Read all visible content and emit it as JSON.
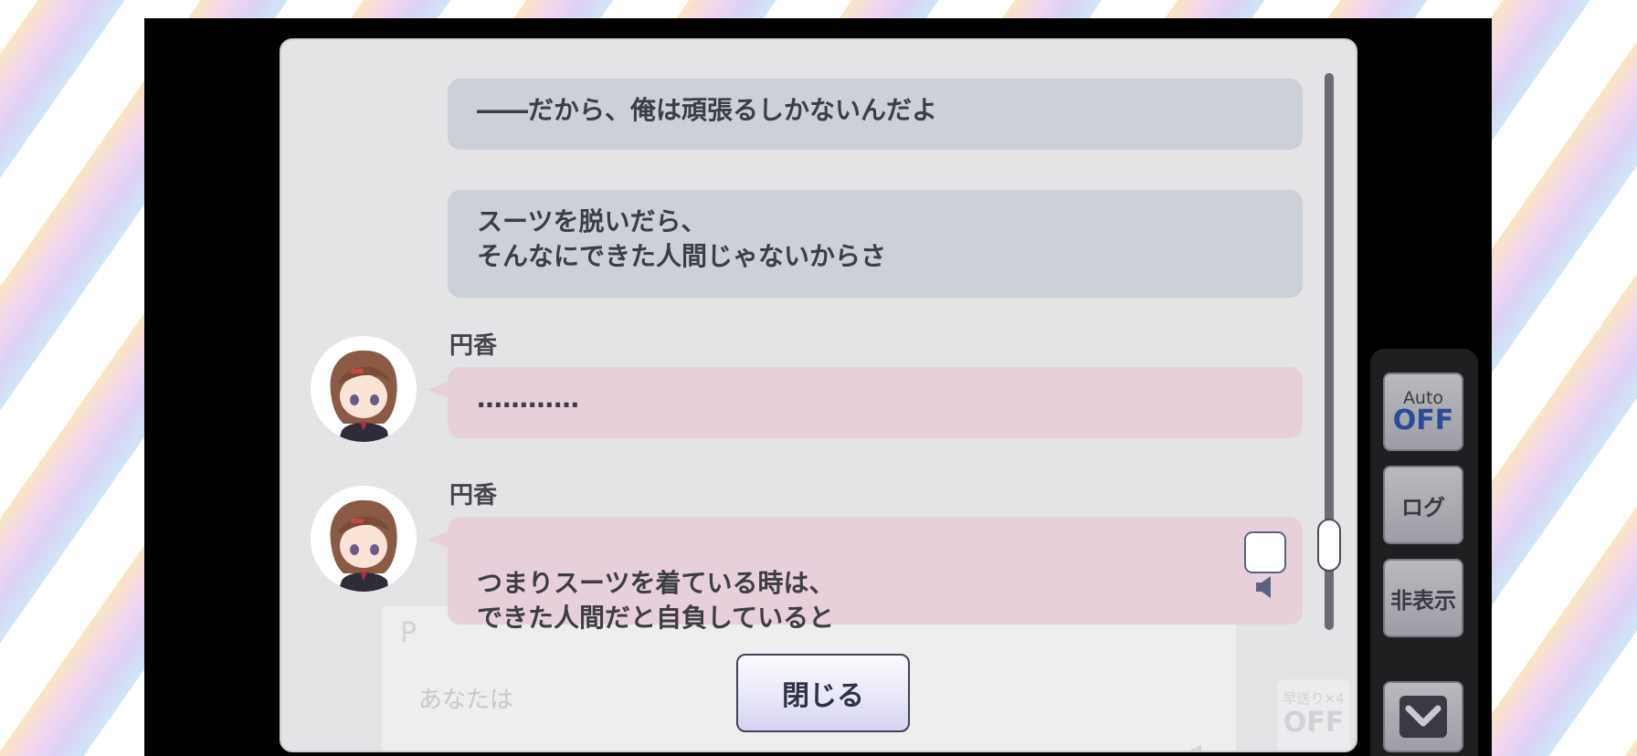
{
  "log": {
    "entries": [
      {
        "type": "narration",
        "text": "――だから、俺は頑張るしかないんだよ"
      },
      {
        "type": "narration",
        "text": "スーツを脱いだら、\nそんなにできた人間じゃないからさ"
      },
      {
        "type": "dialogue",
        "speaker": "円香",
        "text": "…………"
      },
      {
        "type": "dialogue",
        "speaker": "円香",
        "text": "つまりスーツを着ている時は、\nできた人間だと自負していると",
        "voice": "speaker-icon"
      }
    ],
    "close_label": "閉じる"
  },
  "background_ui": {
    "prompt_text": "あなたは",
    "fast_forward_label": "早送り×4",
    "fast_forward_state": "OFF",
    "player_initial": "P"
  },
  "side_menu": {
    "auto_label": "Auto",
    "auto_state": "OFF",
    "log_label": "ログ",
    "hide_label": "非表示",
    "collapse_icon": "chevron-down-icon"
  },
  "colors": {
    "accent_blue": "#2b4a9c",
    "narration_bubble": "#ccd0d7",
    "dialogue_bubble": "#e8d0db"
  }
}
